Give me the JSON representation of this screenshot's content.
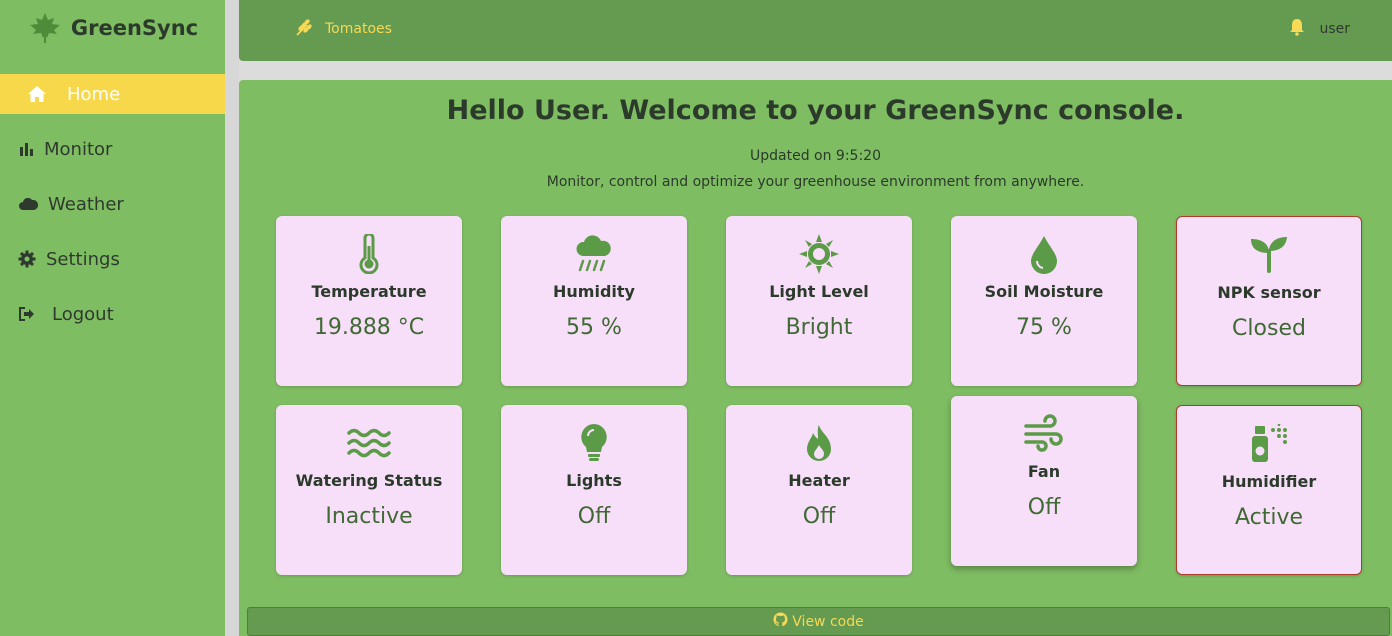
{
  "brand": {
    "name": "GreenSync",
    "logo_icon": "leaf-icon"
  },
  "nav": [
    {
      "label": "Home",
      "icon": "home-icon",
      "active": true
    },
    {
      "label": "Monitor",
      "icon": "bar-chart-icon",
      "active": false
    },
    {
      "label": "Weather",
      "icon": "cloud-icon",
      "active": false
    },
    {
      "label": "Settings",
      "icon": "gear-icon",
      "active": false
    },
    {
      "label": "Logout",
      "icon": "logout-icon",
      "active": false
    }
  ],
  "topbar": {
    "crop": "Tomatoes",
    "crop_icon": "wheat-icon",
    "user": "user",
    "bell_icon": "bell-icon"
  },
  "main": {
    "greeting": "Hello User. Welcome to your GreenSync console.",
    "updated": "Updated on 9:5:20",
    "tagline": "Monitor, control and optimize your greenhouse environment from anywhere."
  },
  "cards": [
    {
      "label": "Temperature",
      "value": "19.888 °C",
      "icon": "thermometer-icon"
    },
    {
      "label": "Humidity",
      "value": "55 %",
      "icon": "cloud-rain-icon"
    },
    {
      "label": "Light Level",
      "value": "Bright",
      "icon": "sun-icon"
    },
    {
      "label": "Soil Moisture",
      "value": "75 %",
      "icon": "droplet-icon"
    },
    {
      "label": "NPK sensor",
      "value": "Closed",
      "icon": "seedling-icon"
    },
    {
      "label": "Watering Status",
      "value": "Inactive",
      "icon": "water-waves-icon"
    },
    {
      "label": "Lights",
      "value": "Off",
      "icon": "lightbulb-icon"
    },
    {
      "label": "Heater",
      "value": "Off",
      "icon": "fire-icon"
    },
    {
      "label": "Fan",
      "value": "Off",
      "icon": "wind-icon"
    },
    {
      "label": "Humidifier",
      "value": "Active",
      "icon": "spray-can-icon"
    }
  ],
  "footer": {
    "view_code": "View code",
    "icon": "github-icon"
  },
  "colors": {
    "sidebar": "#7fbd63",
    "topbar": "#659a51",
    "active_nav": "#f8d84b",
    "card_bg": "#f8dff9",
    "accent_text": "#f6d955",
    "alert_border": "#b23a2a"
  }
}
